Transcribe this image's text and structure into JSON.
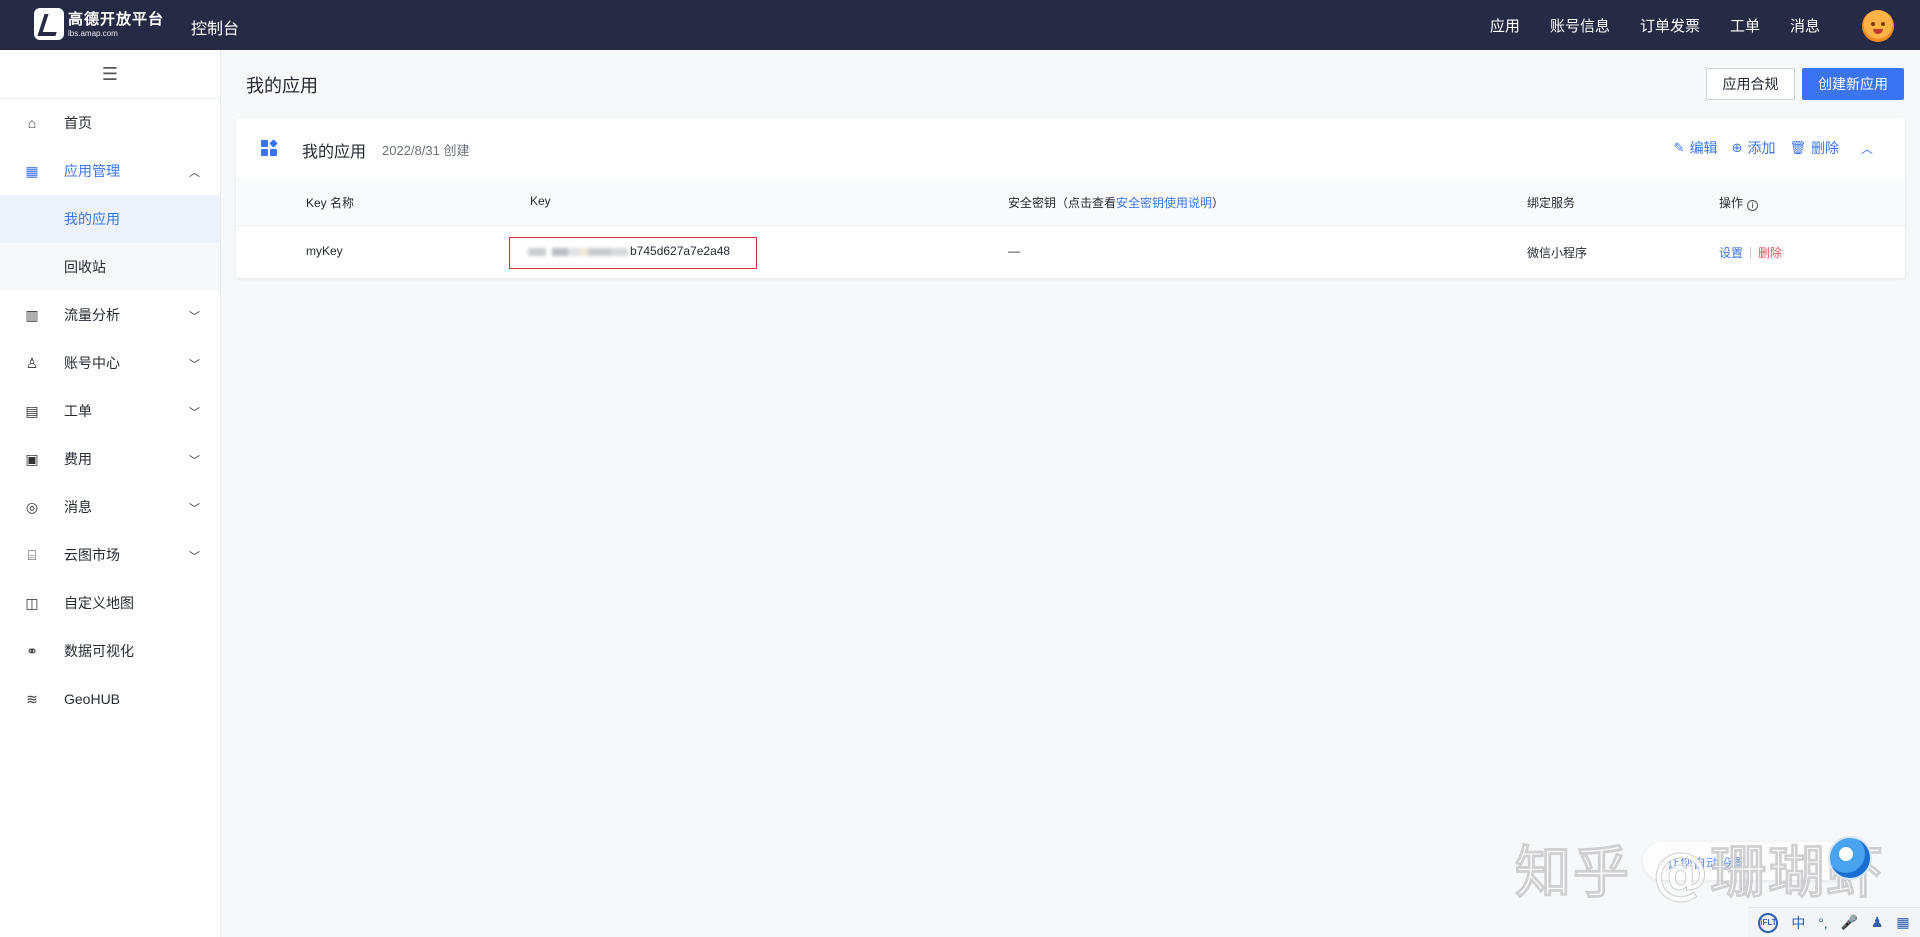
{
  "header": {
    "logo_title": "高德开放平台",
    "logo_subtitle": "lbs.amap.com",
    "console_label": "控制台",
    "nav": [
      "应用",
      "账号信息",
      "订单发票",
      "工单",
      "消息"
    ]
  },
  "sidebar": {
    "collapse_glyph": "☰",
    "items": [
      {
        "label": "首页"
      },
      {
        "label": "应用管理",
        "expanded": true
      },
      {
        "label": "我的应用",
        "sub": true,
        "selected": true
      },
      {
        "label": "回收站",
        "sub": true
      },
      {
        "label": "流量分析"
      },
      {
        "label": "账号中心"
      },
      {
        "label": "工单"
      },
      {
        "label": "费用"
      },
      {
        "label": "消息"
      },
      {
        "label": "云图市场"
      },
      {
        "label": "自定义地图"
      },
      {
        "label": "数据可视化"
      },
      {
        "label": "GeoHUB"
      }
    ]
  },
  "main": {
    "page_title": "我的应用",
    "compliance_button": "应用合规",
    "create_button": "创建新应用",
    "card": {
      "title": "我的应用",
      "created": "2022/8/31 创建",
      "actions": {
        "edit": "编辑",
        "add": "添加",
        "delete": "删除"
      },
      "table": {
        "headers": {
          "key_name": "Key 名称",
          "key": "Key",
          "secret_prefix": "安全密钥（点击查看",
          "secret_link": "安全密钥使用说明",
          "secret_suffix": "）",
          "service": "绑定服务",
          "ops": "操作"
        },
        "rows": [
          {
            "key_name": "myKey",
            "key_visible": "b745d627a7e2a48",
            "secret": "—",
            "service": "微信小程序",
            "op_settings": "设置",
            "op_delete": "删除"
          }
        ]
      }
    }
  },
  "overlay": {
    "watermark": "知乎 @珊瑚虾",
    "floating_text": "让您自动设置",
    "ime_lang": "中"
  },
  "colors": {
    "header_bg": "#262b45",
    "accent": "#3b74f3",
    "danger": "#e8505b",
    "highlight_border": "#d0343a"
  }
}
